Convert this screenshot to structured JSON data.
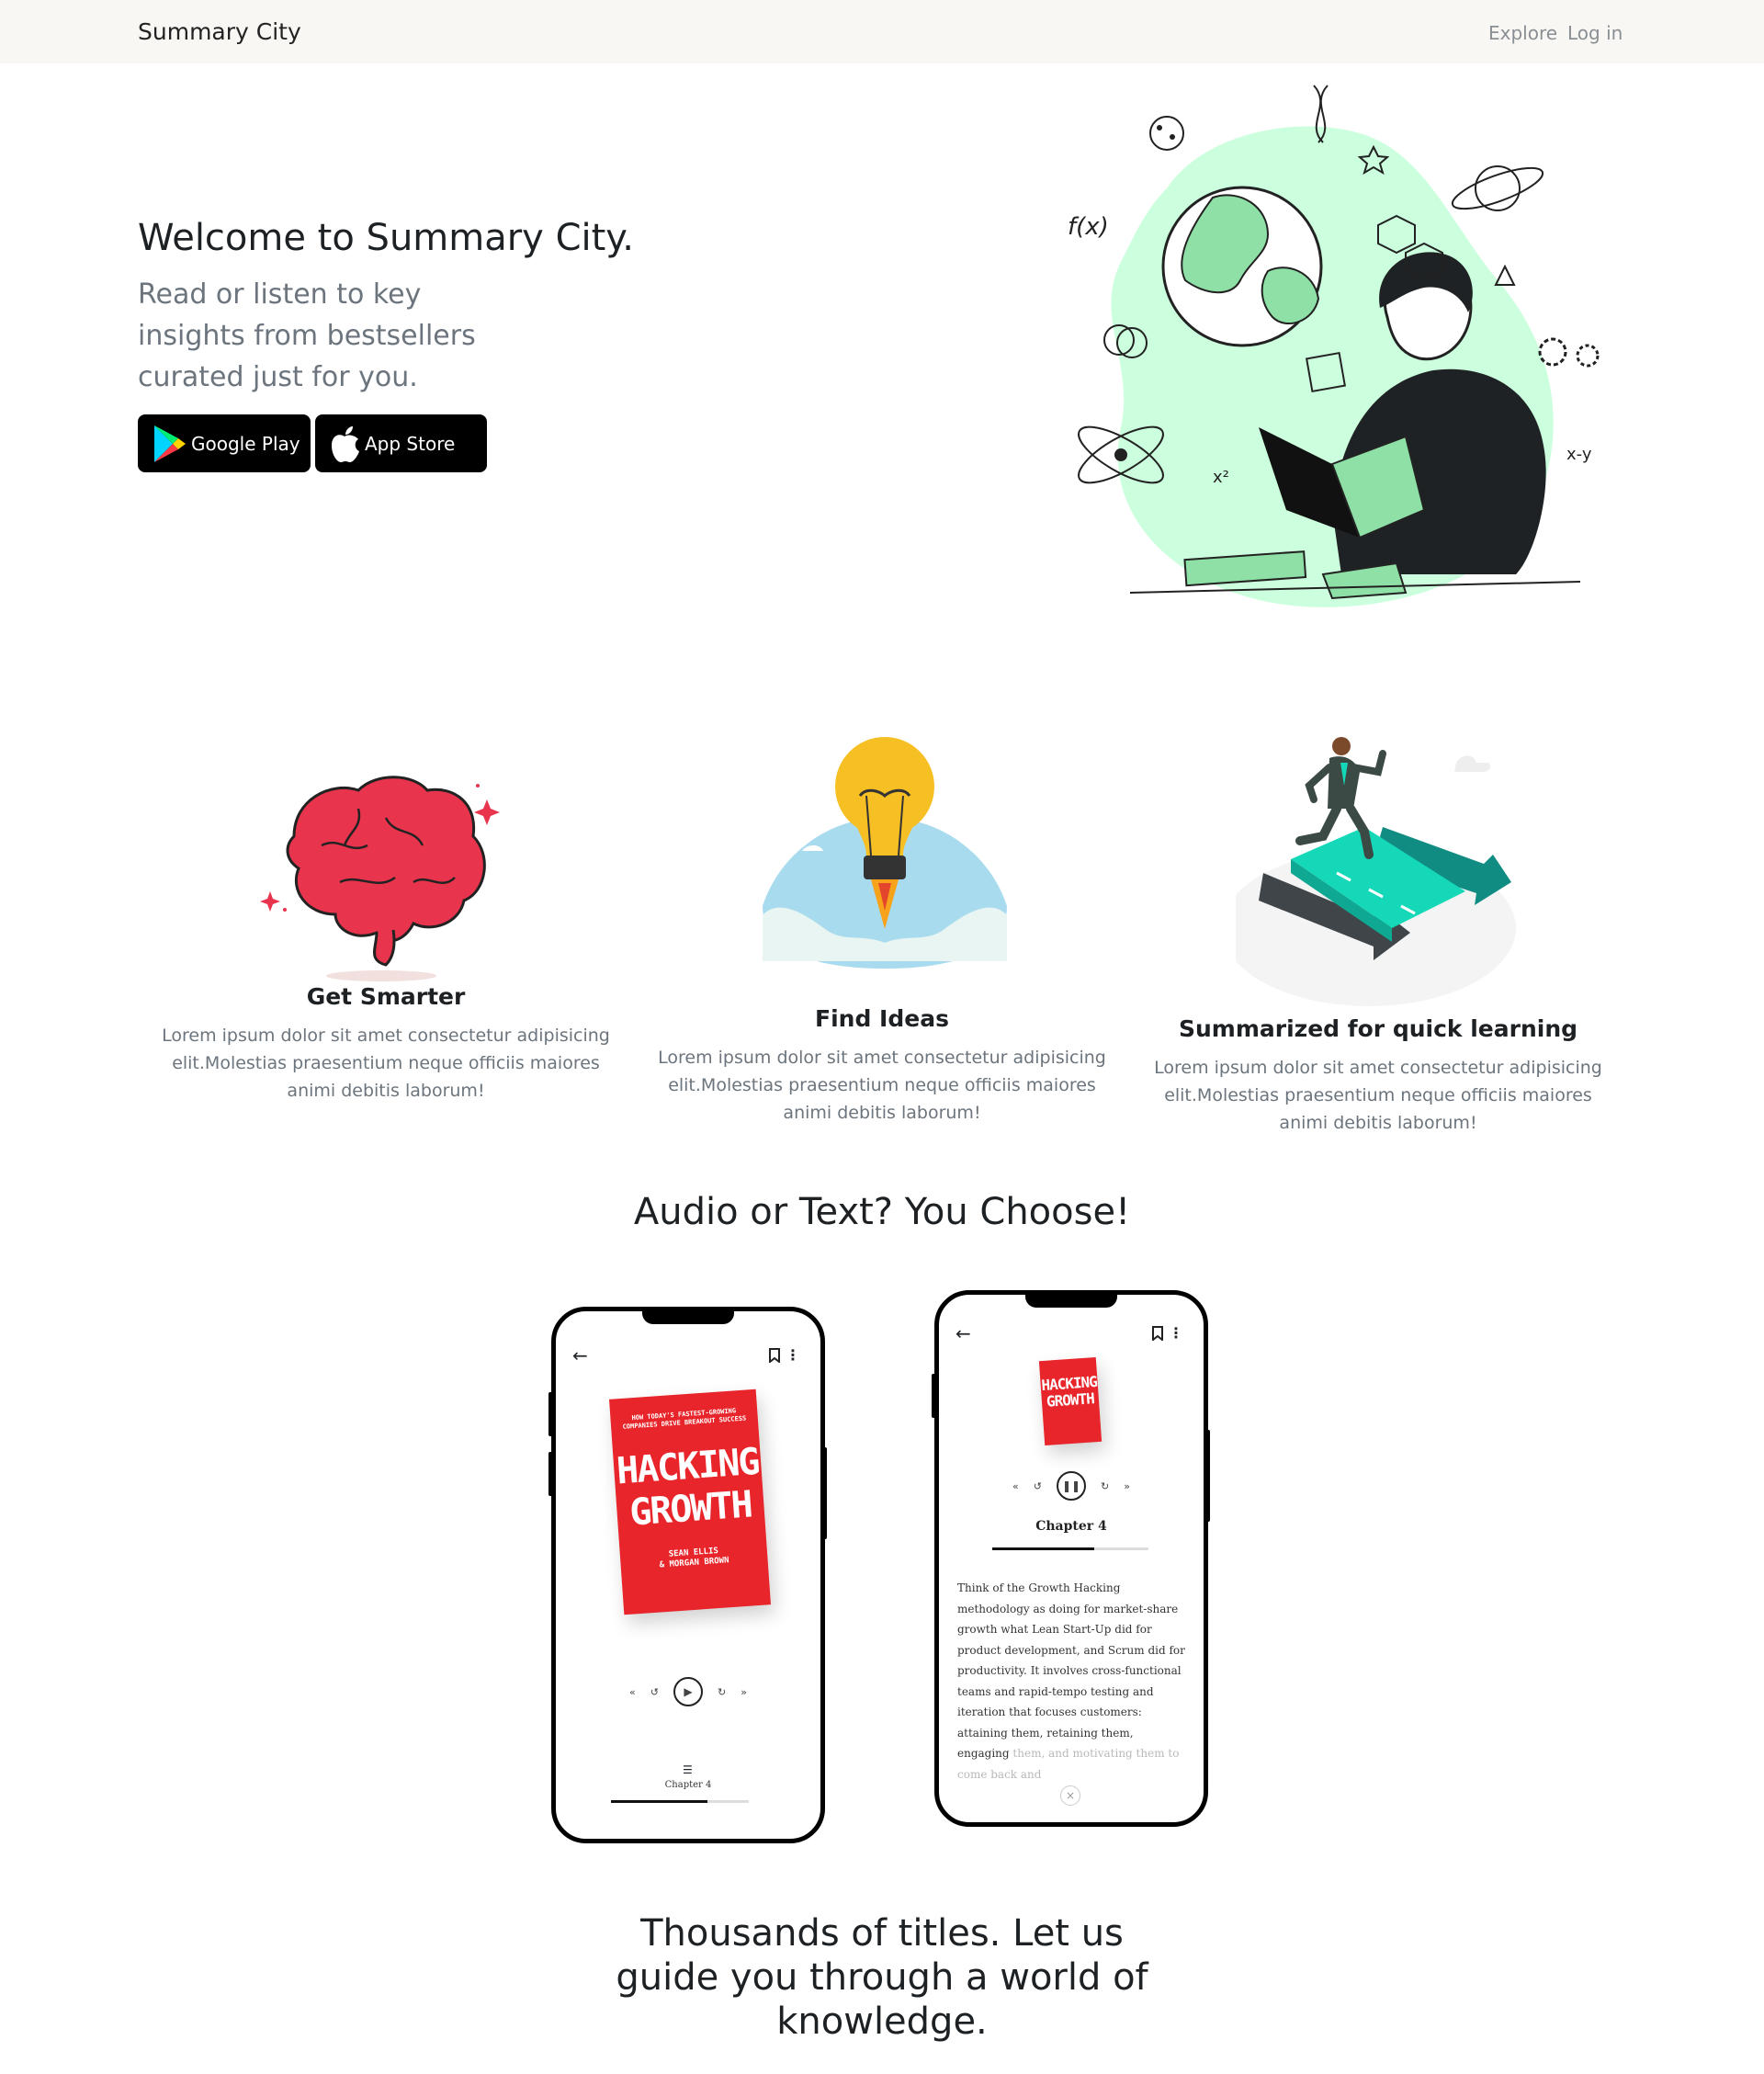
{
  "navbar": {
    "brand": "Summary City",
    "links": {
      "explore": "Explore",
      "login": "Log in"
    }
  },
  "hero": {
    "title": "Welcome to Summary City.",
    "subtitle": "Read or listen to key insights from bestsellers curated just for you.",
    "buttons": {
      "google": "Google Play",
      "apple": "App Store"
    }
  },
  "features": [
    {
      "title": "Get Smarter",
      "text": "Lorem ipsum dolor sit amet consectetur adipisicing elit.Molestias praesentium neque officiis maiores animi debitis laborum!",
      "icon": "brain-illustration"
    },
    {
      "title": "Find Ideas",
      "text": "Lorem ipsum dolor sit amet consectetur adipisicing elit.Molestias praesentium neque officiis maiores animi debitis laborum!",
      "icon": "lightbulb-rocket-illustration"
    },
    {
      "title": "Summarized for quick learning",
      "text": "Lorem ipsum dolor sit amet consectetur adipisicing elit.Molestias praesentium neque officiis maiores animi debitis laborum!",
      "icon": "runner-arrows-illustration"
    }
  ],
  "audio_section": {
    "title": "Audio or Text? You Choose!"
  },
  "phones": {
    "book": {
      "tagline": "HOW TODAY'S FASTEST-GROWING COMPANIES DRIVE BREAKOUT SUCCESS",
      "title_line1": "HACKING",
      "title_line2": "GROWTH",
      "author1": "SEAN ELLIS",
      "author2": "& MORGAN BROWN"
    },
    "chapter": "Chapter 4",
    "reader_text": "Think of the Growth Hacking methodology as doing for market-share growth what Lean Start-Up did for product development, and Scrum did for productivity. It involves cross-functional teams and rapid-tempo testing and iteration that focuses customers: attaining them, retaining them, engaging",
    "reader_text_fade": " them, and motivating them to come back and",
    "close": "×"
  },
  "closing": {
    "title": "Thousands of titles. Let us guide you through a world of knowledge."
  },
  "colors": {
    "accent_green": "#ccffdd",
    "cover_red": "#e8252a",
    "teal": "#14d8b8"
  }
}
